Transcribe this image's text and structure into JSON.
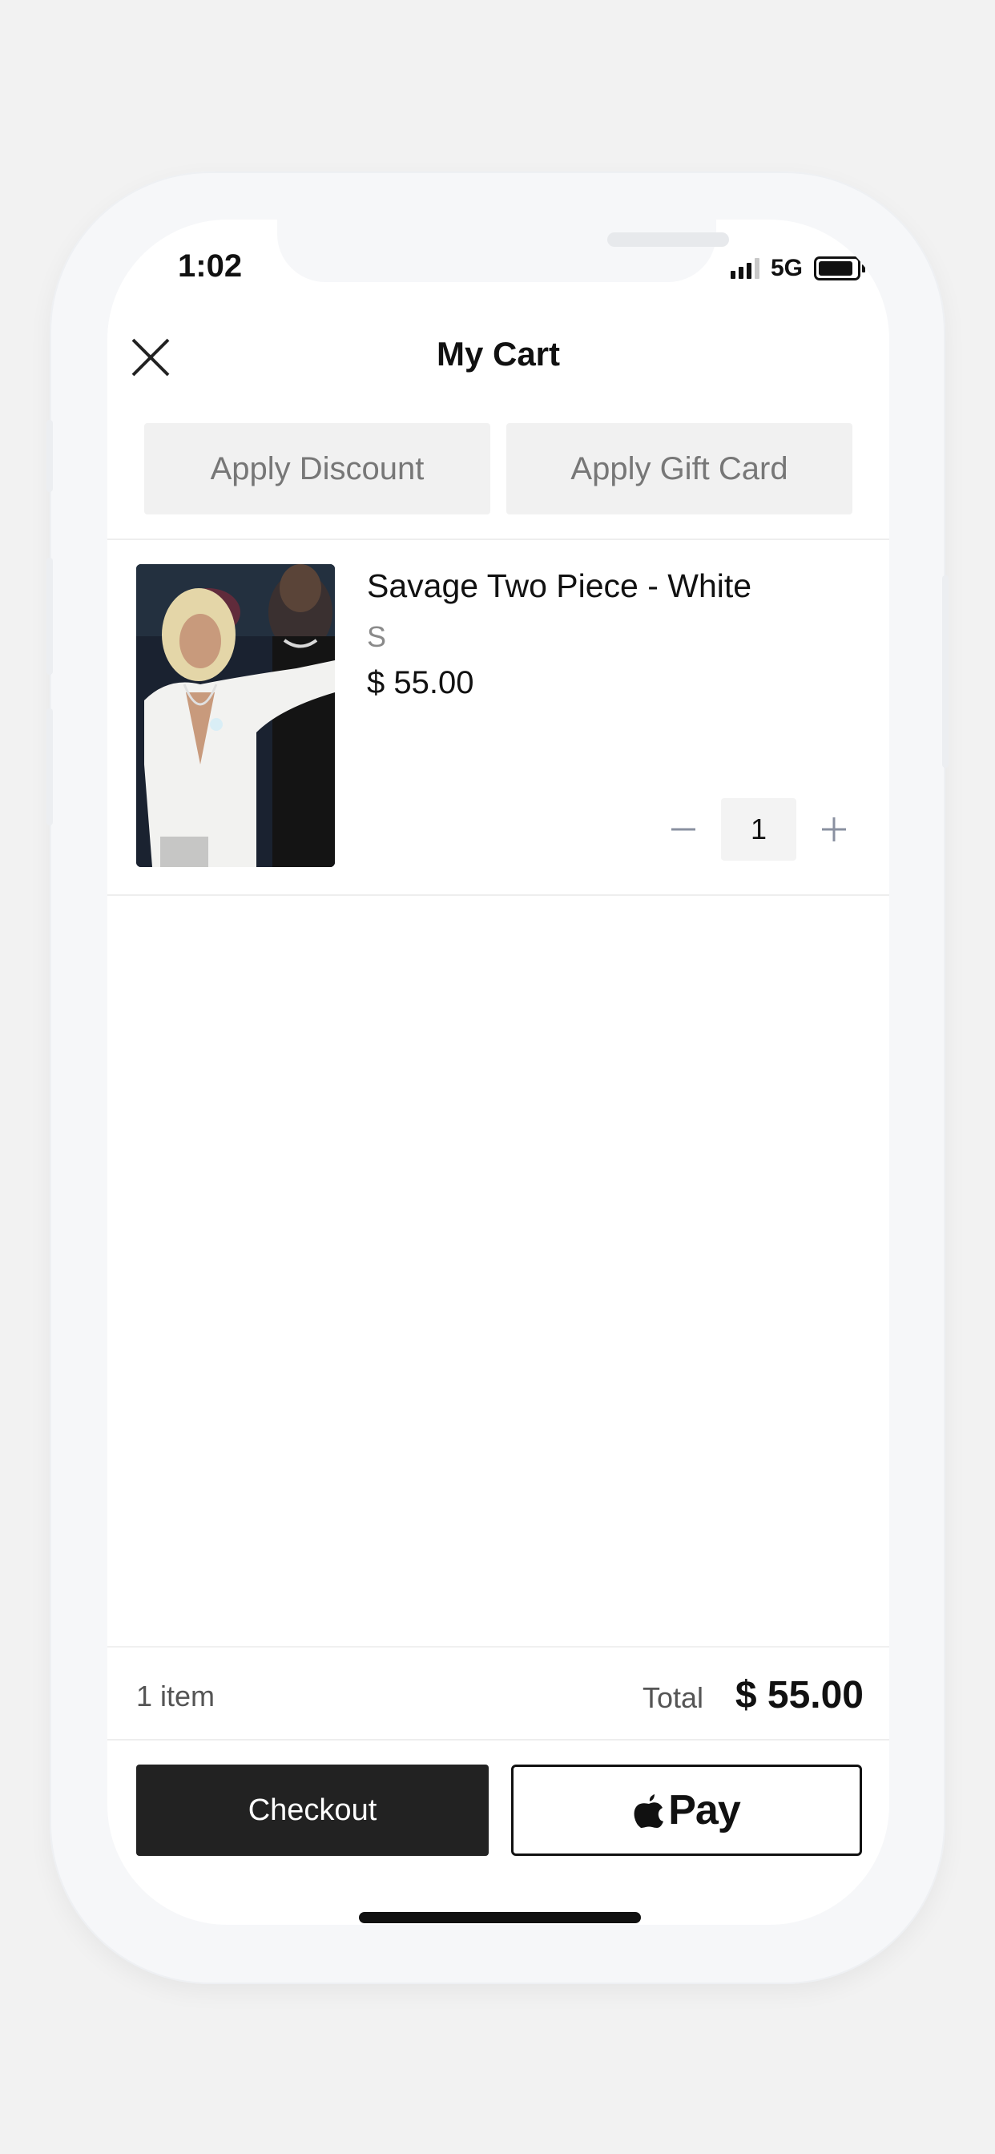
{
  "status_bar": {
    "time": "1:02",
    "network": "5G"
  },
  "header": {
    "title": "My Cart",
    "close_icon": "close-icon"
  },
  "actions": {
    "apply_discount": "Apply Discount",
    "apply_gift_card": "Apply Gift Card"
  },
  "cart": {
    "items": [
      {
        "name": "Savage Two Piece - White",
        "size": "S",
        "price": "$ 55.00",
        "quantity": "1",
        "minus_icon": "minus-icon",
        "plus_icon": "plus-icon"
      }
    ]
  },
  "summary": {
    "item_count": "1 item",
    "total_label": "Total",
    "total_value": "$ 55.00"
  },
  "footer": {
    "checkout_label": "Checkout",
    "apple_pay_label": "Pay",
    "apple_icon": "apple-icon"
  },
  "colors": {
    "background": "#f2f2f2",
    "button_grey": "#f1f1f1",
    "checkout_dark": "#222222",
    "qty_icon": "#8a90a0"
  }
}
